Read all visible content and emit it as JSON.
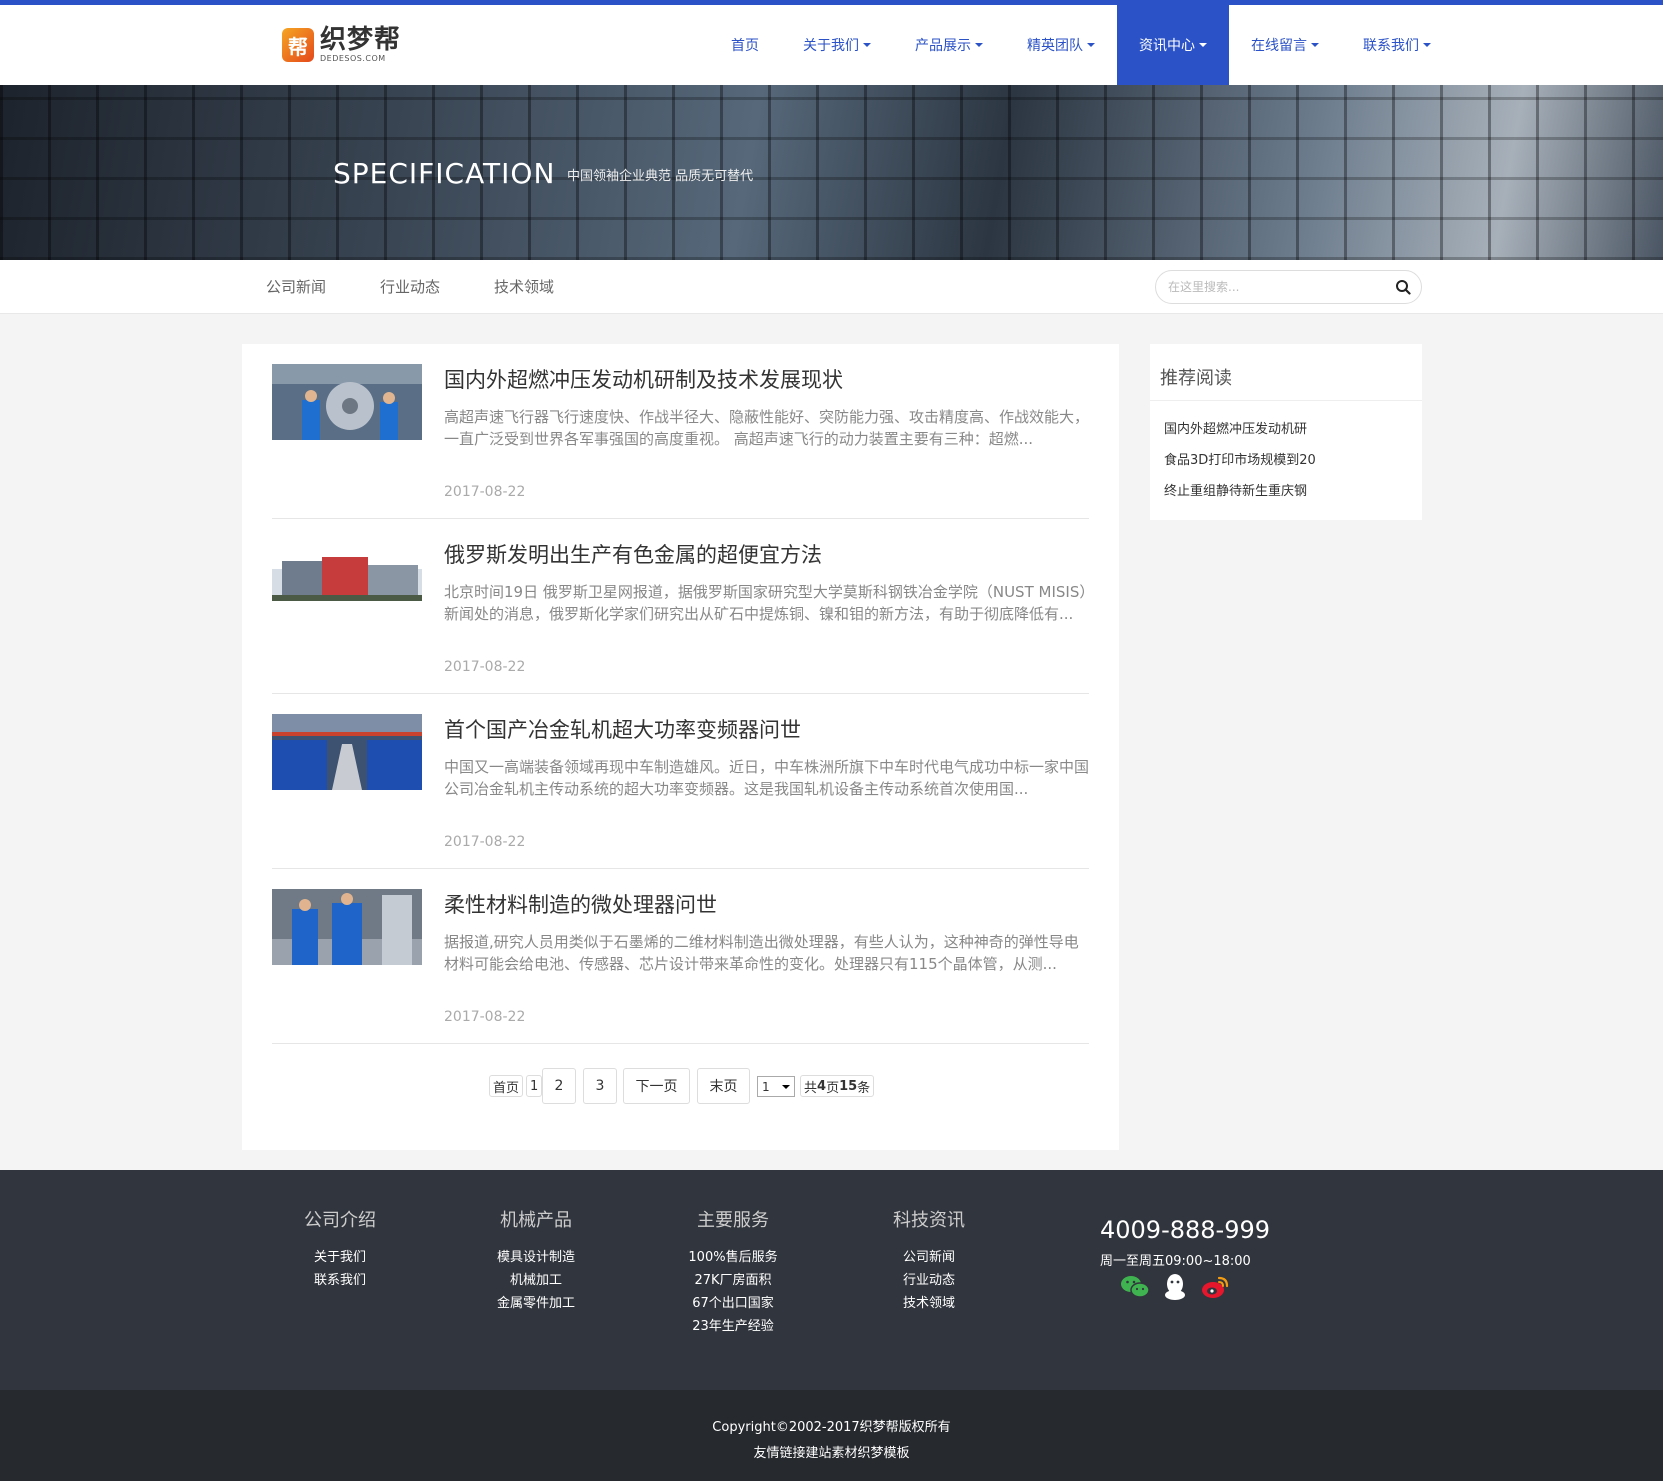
{
  "header": {
    "logo_mark": "帮",
    "logo_name": "织梦帮",
    "logo_sub": "DEDESOS.COM",
    "nav": [
      {
        "label": "首页",
        "dropdown": false,
        "active": false
      },
      {
        "label": "关于我们",
        "dropdown": true,
        "active": false
      },
      {
        "label": "产品展示",
        "dropdown": true,
        "active": false
      },
      {
        "label": "精英团队",
        "dropdown": true,
        "active": false
      },
      {
        "label": "资讯中心",
        "dropdown": true,
        "active": true
      },
      {
        "label": "在线留言",
        "dropdown": true,
        "active": false
      },
      {
        "label": "联系我们",
        "dropdown": true,
        "active": false
      }
    ]
  },
  "banner": {
    "title": "SPECIFICATION",
    "subtitle": "中国领袖企业典范 品质无可替代"
  },
  "subnav": {
    "items": [
      "公司新闻",
      "行业动态",
      "技术领域"
    ],
    "search_placeholder": "在这里搜索..."
  },
  "articles": [
    {
      "title": "国内外超燃冲压发动机研制及技术发展现状",
      "desc": "高超声速飞行器飞行速度快、作战半径大、隐蔽性能好、突防能力强、攻击精度高、作战效能大，一直广泛受到世界各军事强国的高度重视。 高超声速飞行的动力装置主要有三种：超燃...",
      "date": "2017-08-22"
    },
    {
      "title": "俄罗斯发明出生产有色金属的超便宜方法",
      "desc": "北京时间19日 俄罗斯卫星网报道，据俄罗斯国家研究型大学莫斯科钢铁冶金学院（NUST MISIS）新闻处的消息，俄罗斯化学家们研究出从矿石中提炼铜、镍和钼的新方法，有助于彻底降低有...",
      "date": "2017-08-22"
    },
    {
      "title": "首个国产冶金轧机超大功率变频器问世",
      "desc": "中国又一高端装备领域再现中车制造雄风。近日，中车株洲所旗下中车时代电气成功中标一家中国公司冶金轧机主传动系统的超大功率变频器。这是我国轧机设备主传动系统首次使用国...",
      "date": "2017-08-22"
    },
    {
      "title": "柔性材料制造的微处理器问世",
      "desc": "据报道,研究人员用类似于石墨烯的二维材料制造出微处理器，有些人认为，这种神奇的弹性导电材料可能会给电池、传感器、芯片设计带来革命性的变化。处理器只有115个晶体管，从测...",
      "date": "2017-08-22"
    }
  ],
  "pager": {
    "first": "首页",
    "current": "1",
    "p2": "2",
    "p3": "3",
    "next": "下一页",
    "last": "末页",
    "select_value": "1",
    "summary_prefix": "共",
    "summary_pages": "4",
    "summary_mid": "页",
    "summary_count": "15",
    "summary_suffix": "条"
  },
  "sidebar": {
    "title": "推荐阅读",
    "links": [
      "国内外超燃冲压发动机研",
      "食品3D打印市场规模到20",
      "终止重组静待新生重庆钢"
    ]
  },
  "footer": {
    "cols": [
      {
        "head": "公司介绍",
        "links": [
          "关于我们",
          "联系我们"
        ]
      },
      {
        "head": "机械产品",
        "links": [
          "模具设计制造",
          "机械加工",
          "金属零件加工"
        ]
      },
      {
        "head": "主要服务",
        "links": [
          "100%售后服务",
          "27K厂房面积",
          "67个出口国家",
          "23年生产经验"
        ]
      },
      {
        "head": "科技资讯",
        "links": [
          "公司新闻",
          "行业动态",
          "技术领域"
        ]
      }
    ],
    "phone": "4009-888-999",
    "hours": "周一至周五09:00~18:00",
    "social_icons": [
      "wechat-icon",
      "qq-icon",
      "weibo-icon"
    ],
    "copyright": "Copyright©2002-2017织梦帮版权所有",
    "friend_links_label": "友情链接",
    "friend_links": [
      "建站素材",
      "织梦模板"
    ]
  },
  "colors": {
    "brand_blue": "#2b52c6",
    "footer_bg": "#31353d",
    "copyright_bg": "#26292e"
  }
}
